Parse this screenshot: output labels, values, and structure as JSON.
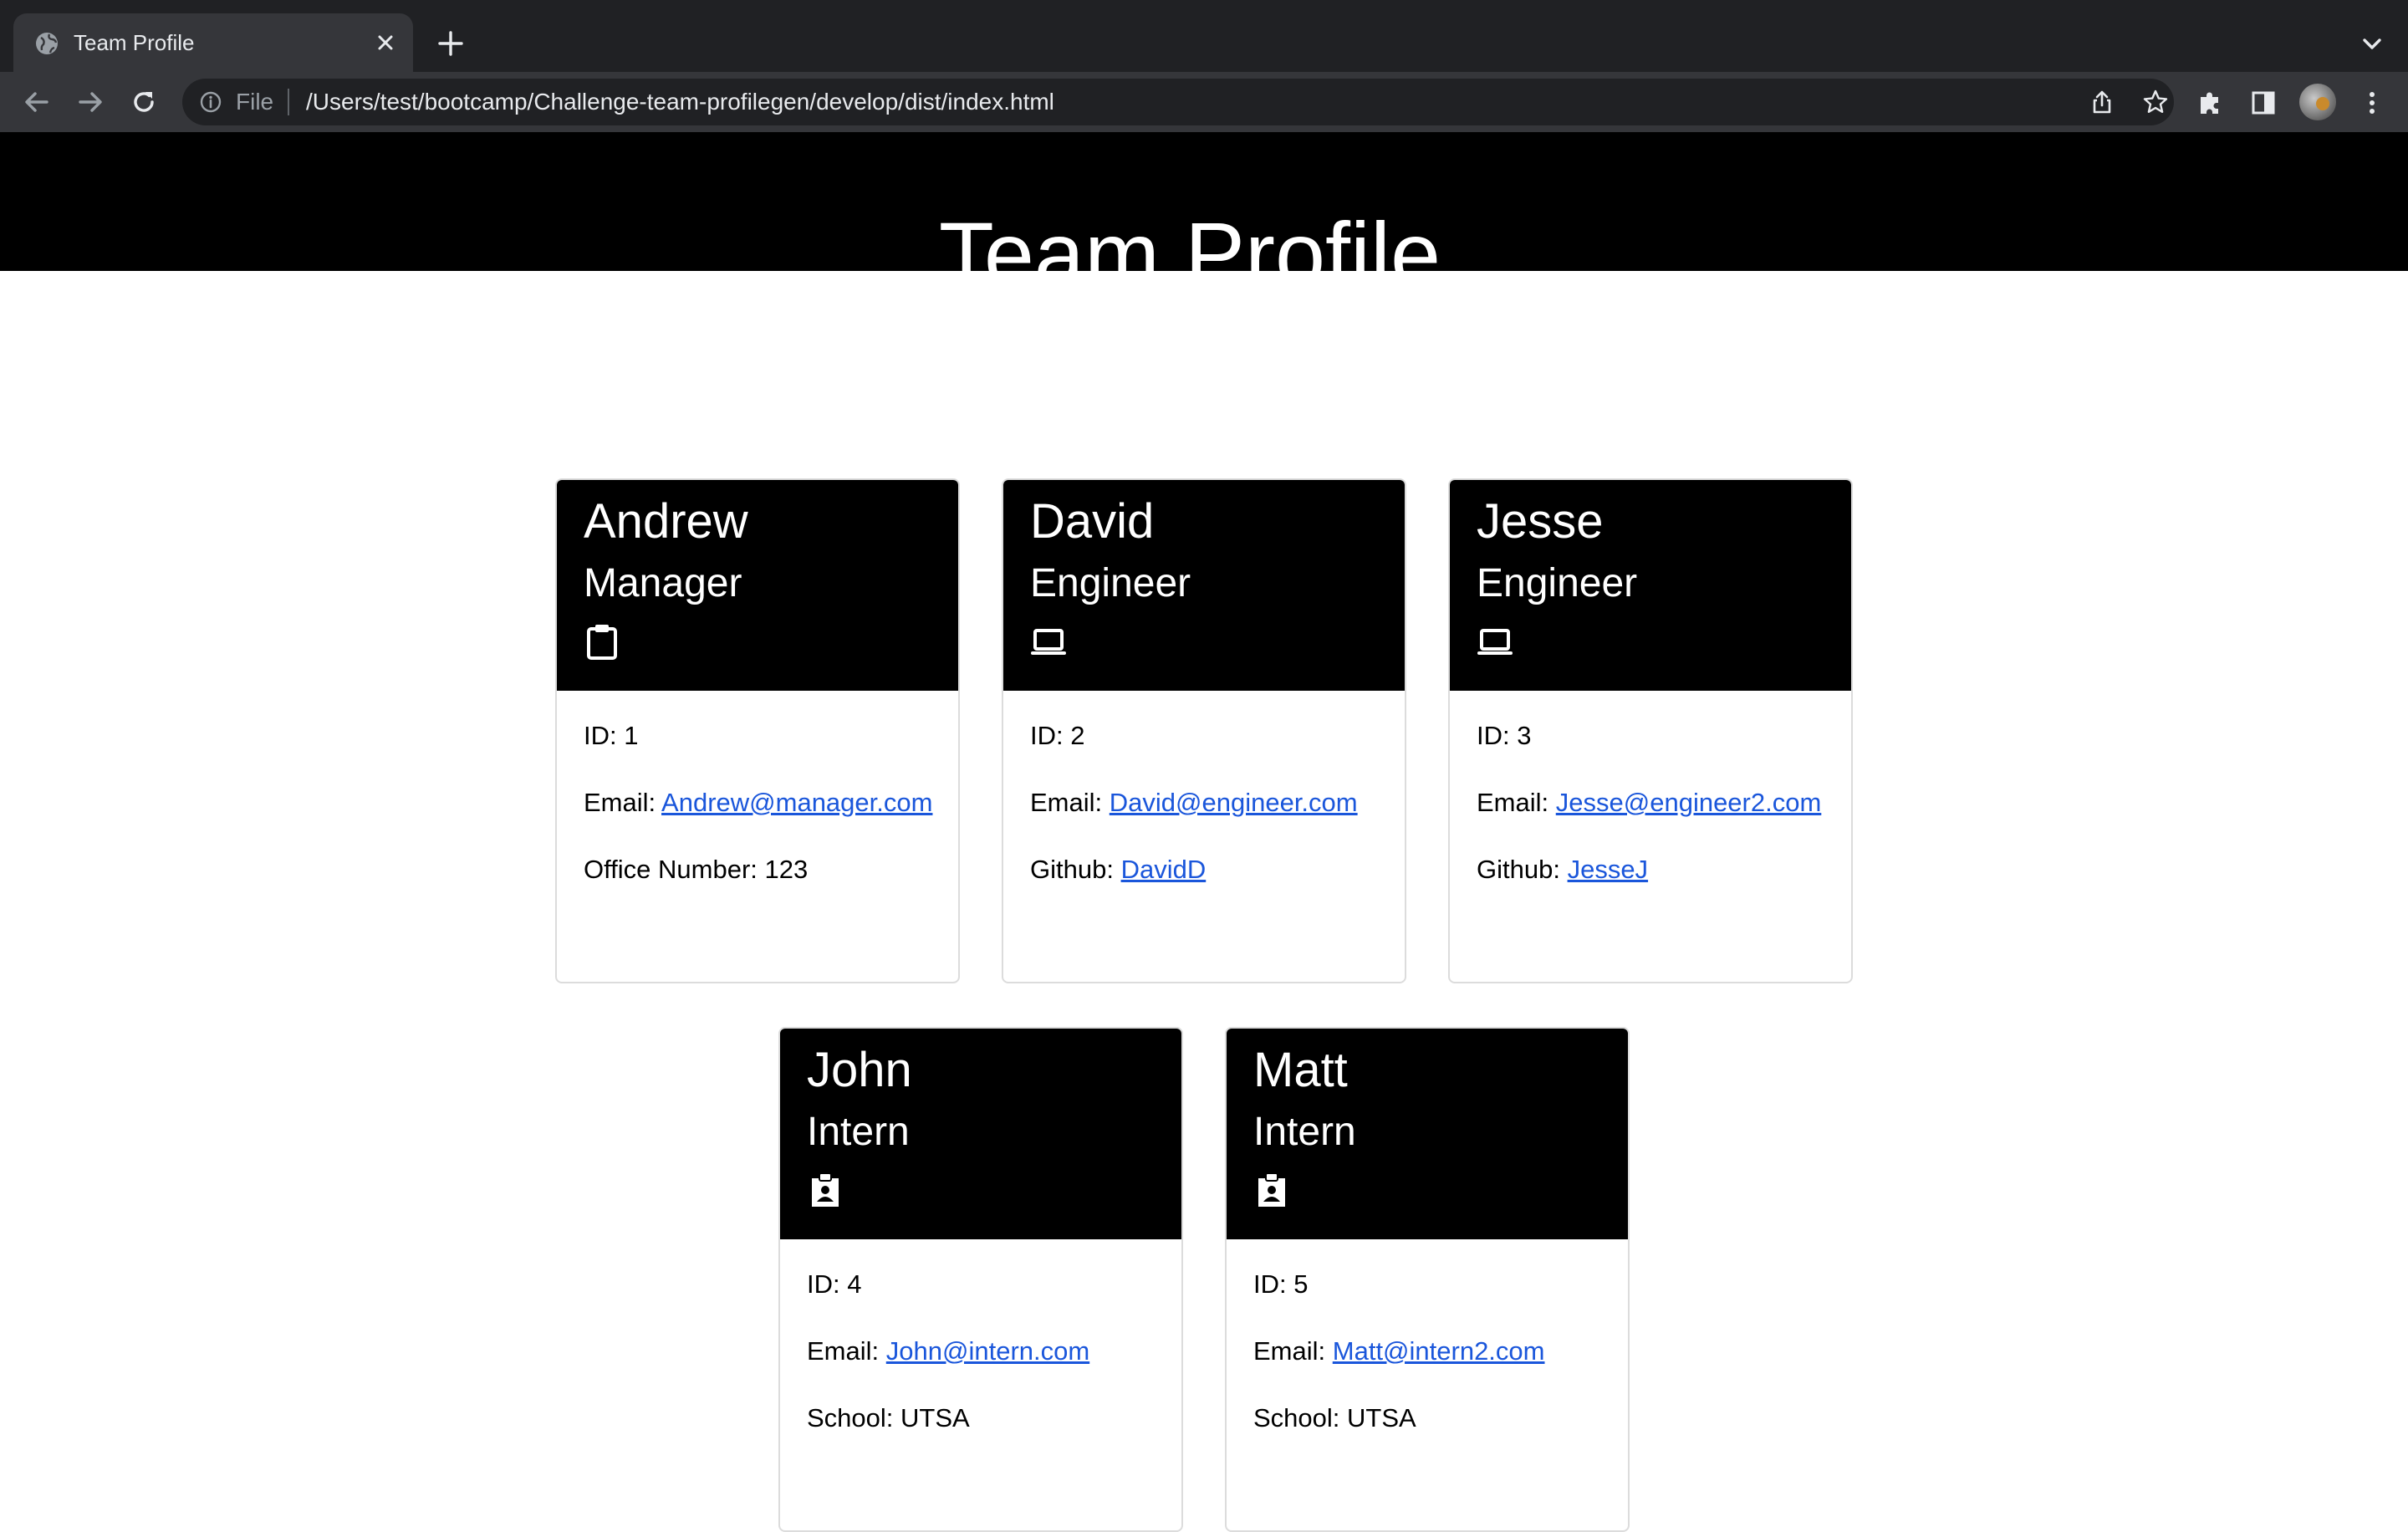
{
  "browser": {
    "tab_title": "Team Profile",
    "omnibox_scheme": "File",
    "url": "/Users/test/bootcamp/Challenge-team-profilegen/develop/dist/index.html"
  },
  "page": {
    "title": "Team Profile"
  },
  "employees": [
    {
      "name": "Andrew",
      "role": "Manager",
      "icon": "clipboard-icon",
      "id_text": "ID: 1",
      "email_label": "Email:",
      "email": "Andrew@manager.com",
      "extra_label": "Office Number: 123",
      "extra_link": ""
    },
    {
      "name": "David",
      "role": "Engineer",
      "icon": "laptop-icon",
      "id_text": "ID: 2",
      "email_label": "Email:",
      "email": "David@engineer.com",
      "extra_label": "Github:",
      "extra_link": "DavidD"
    },
    {
      "name": "Jesse",
      "role": "Engineer",
      "icon": "laptop-icon",
      "id_text": "ID: 3",
      "email_label": "Email:",
      "email": "Jesse@engineer2.com",
      "extra_label": "Github:",
      "extra_link": "JesseJ"
    },
    {
      "name": "John",
      "role": "Intern",
      "icon": "id-badge-icon",
      "id_text": "ID: 4",
      "email_label": "Email:",
      "email": "John@intern.com",
      "extra_label": "School: UTSA",
      "extra_link": ""
    },
    {
      "name": "Matt",
      "role": "Intern",
      "icon": "id-badge-icon",
      "id_text": "ID: 5",
      "email_label": "Email:",
      "email": "Matt@intern2.com",
      "extra_label": "School: UTSA",
      "extra_link": ""
    }
  ],
  "colors": {
    "header_bg": "#000000",
    "link": "#1a56db",
    "chrome_dark": "#202124",
    "chrome_toolbar": "#35363a"
  }
}
